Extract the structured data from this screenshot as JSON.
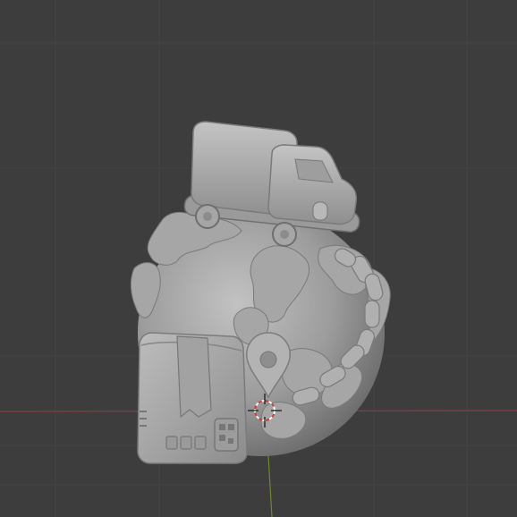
{
  "viewport": {
    "view": "perspective",
    "shading": "solid",
    "background_color": "#3d3d3d",
    "grid_color": "#454545",
    "x_axis_color": "#8a3b45",
    "y_axis_color": "#6b8a2d",
    "model_color": "#a9a9a9"
  },
  "scene": {
    "objects": [
      {
        "icon": "delivery-truck"
      },
      {
        "icon": "globe"
      },
      {
        "icon": "map-pin"
      },
      {
        "icon": "cardboard-box"
      },
      {
        "icon": "dashed-route"
      }
    ],
    "cursor_icon": "3d-cursor"
  }
}
